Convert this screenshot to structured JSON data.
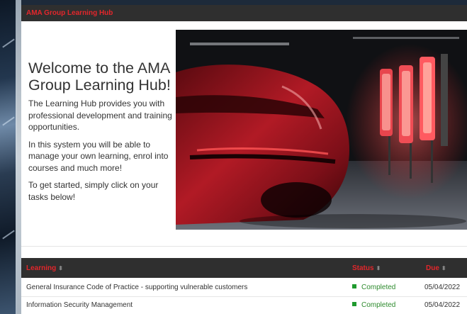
{
  "header": {
    "title": "AMA Group Learning Hub"
  },
  "welcome": {
    "heading": "Welcome to the AMA Group Learning Hub!",
    "para1": "The Learning Hub provides you with professional development and training opportunities.",
    "para2": "In this system you will be able to manage your own learning, enrol into courses and much more!",
    "para3": "To get started, simply click on your tasks below!"
  },
  "table": {
    "columns": {
      "learning": "Learning",
      "status": "Status",
      "due": "Due"
    },
    "rows": [
      {
        "learning": "General Insurance Code of Practice - supporting vulnerable customers",
        "status": "Completed",
        "due": "05/04/2022"
      },
      {
        "learning": "Information Security Management",
        "status": "Completed",
        "due": "05/04/2022"
      }
    ]
  },
  "colors": {
    "accent": "#e3262b",
    "header_bg": "#2f2f2f",
    "status_complete": "#1f9a2e"
  }
}
